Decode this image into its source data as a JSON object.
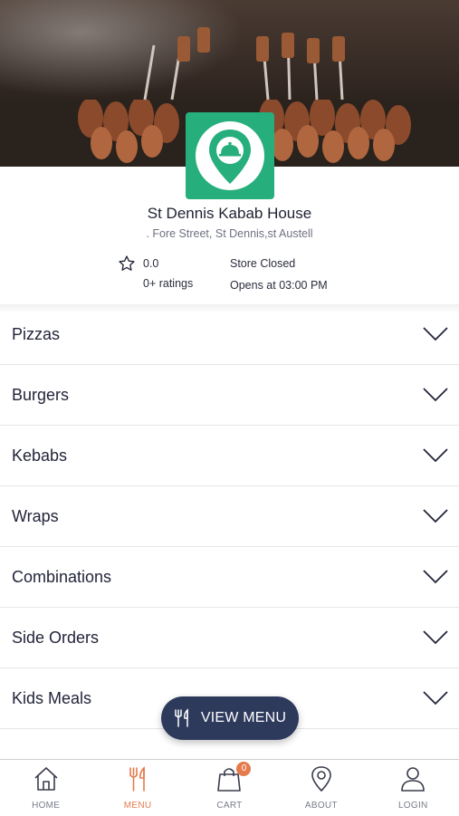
{
  "store": {
    "name": "St Dennis Kabab House",
    "address": ". Fore Street, St Dennis,st Austell",
    "rating": "0.0",
    "ratings_count": "0+ ratings",
    "status": "Store Closed",
    "opens_at": "Opens at 03:00 PM"
  },
  "categories": [
    {
      "label": "Pizzas"
    },
    {
      "label": "Burgers"
    },
    {
      "label": "Kebabs"
    },
    {
      "label": "Wraps"
    },
    {
      "label": "Combinations"
    },
    {
      "label": "Side Orders"
    },
    {
      "label": "Kids Meals"
    }
  ],
  "fab": {
    "label": "VIEW MENU",
    "icon": "utensils-icon"
  },
  "tabbar": {
    "items": [
      {
        "label": "HOME",
        "icon": "home-icon"
      },
      {
        "label": "MENU",
        "icon": "utensils-icon"
      },
      {
        "label": "CART",
        "icon": "shopping-bag-icon",
        "badge": "0"
      },
      {
        "label": "ABOUT",
        "icon": "map-pin-icon"
      },
      {
        "label": "LOGIN",
        "icon": "user-icon"
      }
    ]
  },
  "colors": {
    "accent": "#e57a4c",
    "brand_green": "#27ae7d",
    "fab_bg": "#2d3a5c"
  }
}
